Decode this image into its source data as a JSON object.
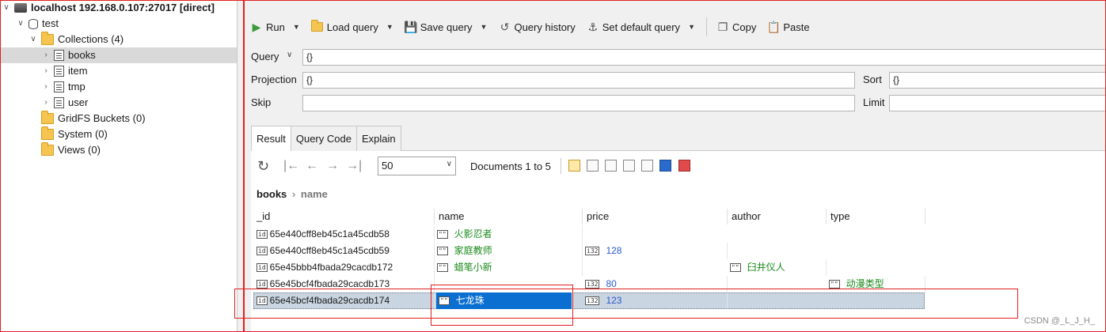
{
  "tree": {
    "connection": "localhost 192.168.0.107:27017 [direct]",
    "database": "test",
    "collections_folder": "Collections (4)",
    "collections": [
      {
        "name": "books",
        "selected": true
      },
      {
        "name": "item",
        "selected": false
      },
      {
        "name": "tmp",
        "selected": false
      },
      {
        "name": "user",
        "selected": false
      }
    ],
    "gridfs": "GridFS Buckets (0)",
    "system": "System (0)",
    "views": "Views (0)"
  },
  "toolbar": {
    "run": "Run",
    "load_query": "Load query",
    "save_query": "Save query",
    "query_history": "Query history",
    "set_default_query": "Set default query",
    "copy": "Copy",
    "paste": "Paste"
  },
  "query_form": {
    "query_label": "Query",
    "query_value": "{}",
    "projection_label": "Projection",
    "projection_value": "{}",
    "sort_label": "Sort",
    "sort_value": "{}",
    "skip_label": "Skip",
    "skip_value": "",
    "limit_label": "Limit",
    "limit_value": ""
  },
  "tabs": [
    "Result",
    "Query Code",
    "Explain"
  ],
  "result": {
    "page_size": "50",
    "doc_range": "Documents 1 to 5",
    "breadcrumb_root": "books",
    "breadcrumb_field": "name"
  },
  "grid": {
    "columns": [
      "_id",
      "name",
      "price",
      "author",
      "type"
    ],
    "rows": [
      {
        "_id": "65e440cff8eb45c1a45cdb58",
        "name": "火影忍者",
        "price": "",
        "author": "",
        "type": ""
      },
      {
        "_id": "65e440cff8eb45c1a45cdb59",
        "name": "家庭教师",
        "price": "128",
        "author": "",
        "type": ""
      },
      {
        "_id": "65e45bbb4fbada29cacdb172",
        "name": "蜡笔小新",
        "price": "",
        "author": "臼井仪人",
        "type": ""
      },
      {
        "_id": "65e45bcf4fbada29cacdb173",
        "name": "",
        "price": "80",
        "author": "",
        "type": "动漫类型"
      },
      {
        "_id": "65e45bcf4fbada29cacdb174",
        "name": "七龙珠",
        "price": "123",
        "author": "",
        "type": ""
      }
    ]
  },
  "watermark": "CSDN @_L_J_H_",
  "colors": {
    "string_value": "#1b8a1b",
    "number_value": "#2a5ad0",
    "selection": "#0a6fd1",
    "annotation_red": "#e02020"
  }
}
